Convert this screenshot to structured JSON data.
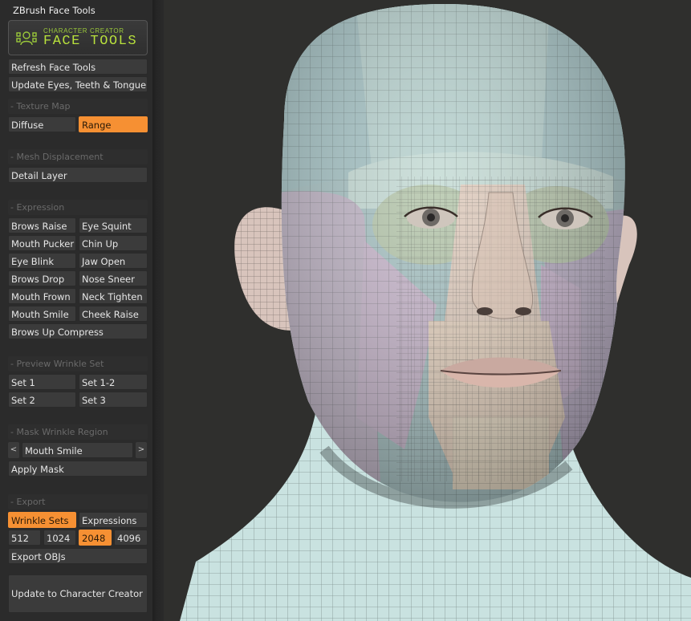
{
  "panel": {
    "title": "ZBrush Face Tools",
    "logo": {
      "line1": "CHARACTER CREATOR",
      "line2": "FACE TOOLS"
    },
    "refresh": "Refresh Face Tools",
    "update_eyes": "Update Eyes, Teeth & Tongue",
    "texture_map": {
      "header": "- Texture Map",
      "diffuse": "Diffuse",
      "range": "Range"
    },
    "mesh_displacement": {
      "header": "- Mesh Displacement",
      "detail_layer": "Detail Layer"
    },
    "expression": {
      "header": "- Expression",
      "items": [
        "Brows Raise",
        "Eye Squint",
        "Mouth Pucker",
        "Chin Up",
        "Eye Blink",
        "Jaw Open",
        "Brows Drop",
        "Nose Sneer",
        "Mouth Frown",
        "Neck Tighten",
        "Mouth Smile",
        "Cheek Raise",
        "Brows Up Compress"
      ]
    },
    "preview_wrinkle": {
      "header": "- Preview Wrinkle Set",
      "sets": [
        "Set 1",
        "Set 1-2",
        "Set 2",
        "Set 3"
      ]
    },
    "mask_wrinkle": {
      "header": "- Mask Wrinkle Region",
      "prev": "<",
      "next": ">",
      "selected": "Mouth Smile",
      "apply": "Apply Mask"
    },
    "export": {
      "header": "- Export",
      "wrinkle_sets": "Wrinkle Sets",
      "expressions": "Expressions",
      "sizes": [
        "512",
        "1024",
        "2048",
        "4096"
      ],
      "selected_size": "2048",
      "export_objs": "Export OBJs",
      "update_cc": "Update to Character Creator"
    }
  },
  "colors": {
    "accent": "#f69033",
    "logo_green": "#b8e13c",
    "panel_bg": "#2b2b2b",
    "viewport_bg": "#2f2f2d"
  },
  "icons": {
    "logo": "face-tools-logo-icon"
  }
}
